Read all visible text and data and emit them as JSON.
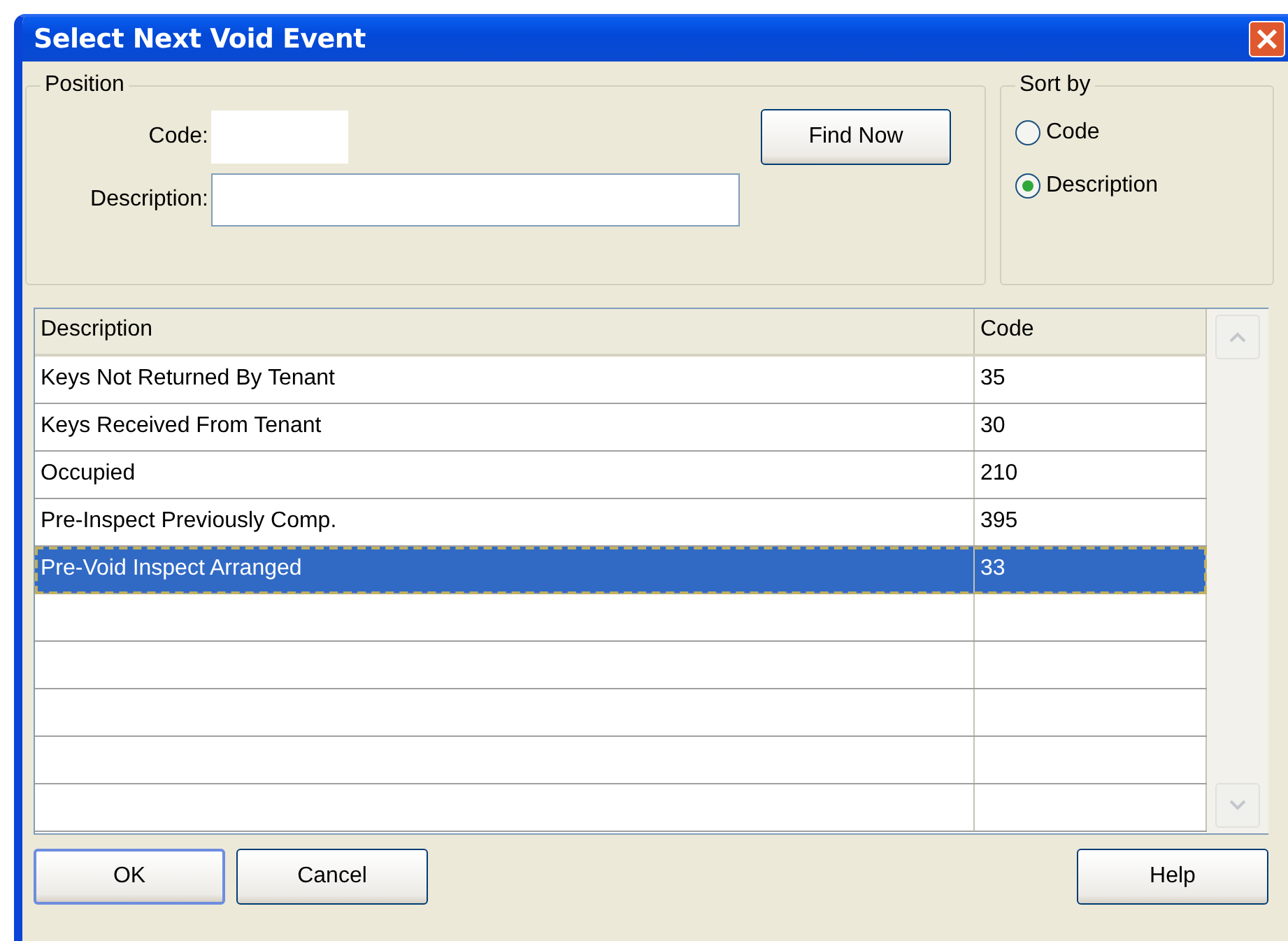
{
  "window": {
    "title": "Select Next Void Event"
  },
  "position": {
    "label": "Position",
    "code_label": "Code:",
    "description_label": "Description:",
    "find_button": "Find Now"
  },
  "sort_by": {
    "label": "Sort by",
    "options": [
      {
        "label": "Code",
        "selected": false
      },
      {
        "label": "Description",
        "selected": true
      }
    ]
  },
  "table": {
    "columns": [
      "Description",
      "Code"
    ],
    "rows": [
      {
        "description": "Keys Not Returned By Tenant",
        "code": "35",
        "selected": false
      },
      {
        "description": "Keys Received From Tenant",
        "code": "30",
        "selected": false
      },
      {
        "description": "Occupied",
        "code": "210",
        "selected": false
      },
      {
        "description": "Pre-Inspect Previously Comp.",
        "code": "395",
        "selected": false
      },
      {
        "description": "Pre-Void Inspect Arranged",
        "code": "33",
        "selected": true
      }
    ]
  },
  "buttons": [
    {
      "label": "OK",
      "default": true
    },
    {
      "label": "Cancel",
      "default": false
    },
    {
      "label": "Help",
      "default": false
    }
  ]
}
